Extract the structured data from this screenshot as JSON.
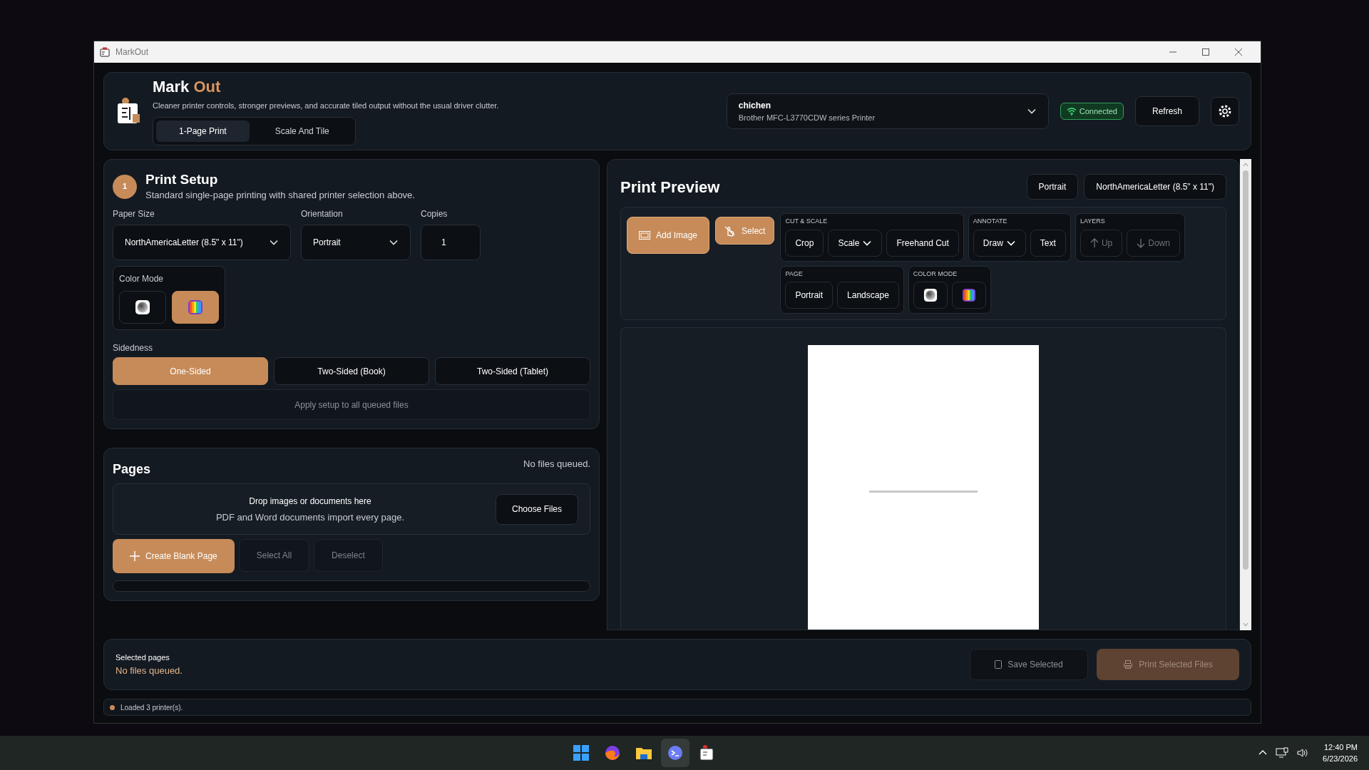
{
  "window": {
    "title": "MarkOut"
  },
  "header": {
    "brand_first": "Mark",
    "brand_second": "Out",
    "tagline": "Cleaner printer controls, stronger previews, and accurate tiled output without the usual driver clutter.",
    "modes": [
      {
        "label": "1-Page Print",
        "selected": true
      },
      {
        "label": "Scale And Tile",
        "selected": false
      }
    ],
    "printer": {
      "name": "chichen",
      "model": "Brother MFC-L3770CDW series Printer"
    },
    "status": "Connected",
    "refresh": "Refresh"
  },
  "print_setup": {
    "step": "1",
    "title": "Print Setup",
    "subtitle": "Standard single-page printing with shared printer selection above.",
    "paper_size": {
      "label": "Paper Size",
      "value": "NorthAmericaLetter (8.5\" x 11\")"
    },
    "orientation": {
      "label": "Orientation",
      "value": "Portrait"
    },
    "copies": {
      "label": "Copies",
      "value": "1"
    },
    "color_mode": {
      "label": "Color Mode",
      "options": [
        {
          "kind": "grayscale",
          "selected": false
        },
        {
          "kind": "color",
          "selected": true
        }
      ]
    },
    "sidedness": {
      "label": "Sidedness",
      "options": [
        {
          "label": "One-Sided",
          "selected": true
        },
        {
          "label": "Two-Sided (Book)",
          "selected": false
        },
        {
          "label": "Two-Sided (Tablet)",
          "selected": false
        }
      ]
    },
    "apply": "Apply setup to all queued files"
  },
  "pages": {
    "title": "Pages",
    "note": "No files queued.",
    "drop_title": "Drop images or documents here",
    "drop_hint": "PDF and Word documents import every page.",
    "choose": "Choose Files",
    "actions": [
      {
        "label": "Create Blank Page",
        "kind": "primary"
      },
      {
        "label": "Select All",
        "kind": "plain",
        "disabled": true
      },
      {
        "label": "Deselect",
        "kind": "plain",
        "disabled": true
      }
    ]
  },
  "preview": {
    "title": "Print Preview",
    "badges": [
      "Portrait",
      "NorthAmericaLetter (8.5\" x 11\")"
    ],
    "main_tools": [
      {
        "label": "Add Image",
        "kind": "add-image"
      },
      {
        "label": "Select",
        "kind": "select"
      }
    ],
    "tool_rows": [
      {
        "groups": [
          {
            "title": "CUT & SCALE",
            "tools": [
              {
                "kind": "text",
                "label": "Crop",
                "disabled": false
              },
              {
                "kind": "dropdown",
                "label": "Scale",
                "disabled": false
              },
              {
                "kind": "text",
                "label": "Freehand Cut",
                "disabled": false
              }
            ]
          },
          {
            "title": "ANNOTATE",
            "tools": [
              {
                "kind": "dropdown",
                "label": "Draw",
                "disabled": false
              },
              {
                "kind": "text",
                "label": "Text",
                "disabled": false
              }
            ]
          },
          {
            "title": "LAYERS",
            "tools": [
              {
                "kind": "up",
                "label": "Up",
                "disabled": true
              },
              {
                "kind": "down",
                "label": "Down",
                "disabled": true
              }
            ]
          }
        ]
      },
      {
        "groups": [
          {
            "title": "PAGE",
            "tools": [
              {
                "kind": "text",
                "label": "Portrait",
                "disabled": false
              },
              {
                "kind": "text",
                "label": "Landscape",
                "disabled": false
              }
            ]
          },
          {
            "title": "COLOR MODE",
            "tools": [
              {
                "kind": "grayscale"
              },
              {
                "kind": "color"
              }
            ]
          }
        ]
      }
    ]
  },
  "footer": {
    "selected_label": "Selected pages",
    "selected_value": "No files queued.",
    "save": {
      "label": "Save Selected",
      "disabled": true
    },
    "print": {
      "label": "Print Selected Files",
      "disabled": true
    }
  },
  "status_bar": {
    "message": "Loaded 3 printer(s)."
  },
  "taskbar": {
    "time": "12:40 PM",
    "date": "6/23/2026"
  }
}
